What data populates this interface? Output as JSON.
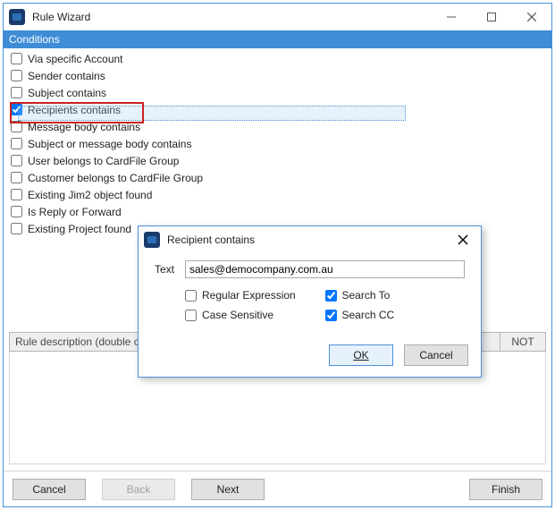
{
  "window": {
    "title": "Rule Wizard",
    "section_header": "Conditions",
    "rule_desc_label": "Rule description (double click",
    "not_label": "NOT"
  },
  "conditions": [
    {
      "label": "Via specific Account",
      "checked": false
    },
    {
      "label": "Sender contains",
      "checked": false
    },
    {
      "label": "Subject contains",
      "checked": false
    },
    {
      "label": "Recipients contains",
      "checked": true,
      "selected": true,
      "highlighted": true
    },
    {
      "label": "Message body contains",
      "checked": false
    },
    {
      "label": "Subject or message body contains",
      "checked": false
    },
    {
      "label": "User belongs to CardFile Group",
      "checked": false
    },
    {
      "label": "Customer belongs to CardFile Group",
      "checked": false
    },
    {
      "label": "Existing Jim2 object found",
      "checked": false
    },
    {
      "label": "Is Reply or Forward",
      "checked": false
    },
    {
      "label": "Existing Project found",
      "checked": false
    }
  ],
  "wizard_buttons": {
    "cancel": "Cancel",
    "back": "Back",
    "next": "Next",
    "finish": "Finish"
  },
  "dialog": {
    "title": "Recipient contains",
    "text_label": "Text",
    "text_value": "sales@democompany.com.au",
    "regex_label": "Regular Expression",
    "regex_checked": false,
    "case_label": "Case Sensitive",
    "case_checked": false,
    "search_to_label": "Search To",
    "search_to_checked": true,
    "search_cc_label": "Search CC",
    "search_cc_checked": true,
    "ok_label": "OK",
    "cancel_label": "Cancel"
  }
}
